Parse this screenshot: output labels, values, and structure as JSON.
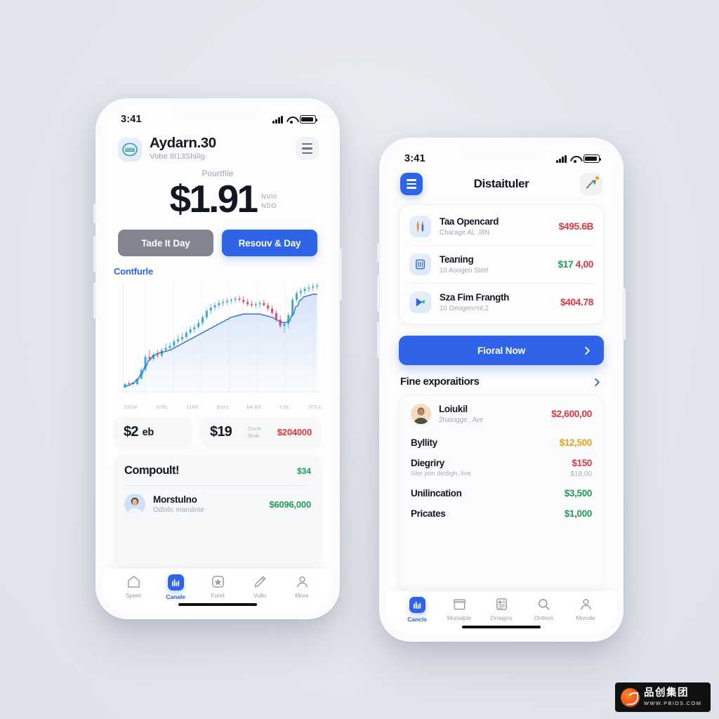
{
  "background_color": "#e3e6ec",
  "accent_blue": "#2f63e8",
  "green": "#1f9d55",
  "red": "#e0373f",
  "amber": "#e7a118",
  "phone1": {
    "status": {
      "time": "3:41",
      "icons": [
        "signal-bars",
        "wifi",
        "battery"
      ]
    },
    "header": {
      "logo_icon": "coin-logo-icon",
      "title": "Aydarn.30",
      "subtitle": "Vobe 8l13Shiilg·",
      "menu_icon": "hamburger-menu-icon"
    },
    "balance": {
      "label": "Pourtfile",
      "amount": "$1.91",
      "unit_lines": [
        "NVI0",
        "NDO"
      ]
    },
    "actions": {
      "secondary_label": "Tade It Day",
      "primary_label": "Resouv & Day"
    },
    "chart": {
      "title": "Contfurle",
      "xticks": [
        "20I34",
        "1I/9L",
        "1160",
        "9/yrs",
        "b4.6d",
        "7,0L",
        "2I7Lc"
      ]
    },
    "stats": {
      "card1_amount": "$2",
      "card1_suffix": "eb",
      "card2_amount": "$19",
      "card2_meta": [
        "Corte",
        "Sirat·"
      ],
      "card2_value": "$204000"
    },
    "bottom_card": {
      "title": "Compoult!",
      "value": "$34",
      "row": {
        "avatar_icon": "user-avatar",
        "title": "Morstulno",
        "subtitle": "Odlolic marolinte",
        "value": "$6096,000"
      }
    },
    "tabbar": [
      {
        "label": "Speet",
        "icon": "home-icon",
        "active": false
      },
      {
        "label": "Canale",
        "icon": "chart-icon",
        "active": true
      },
      {
        "label": "Foret",
        "icon": "star-box-icon",
        "active": false
      },
      {
        "label": "Vullo",
        "icon": "pencil-icon",
        "active": false
      },
      {
        "label": "More",
        "icon": "person-icon",
        "active": false
      }
    ]
  },
  "phone2": {
    "status": {
      "time": "3:41",
      "icons": [
        "signal-bars",
        "wifi",
        "battery"
      ]
    },
    "header": {
      "menu_icon": "hamburger-menu-icon",
      "title": "Distaituler",
      "notify_icon": "colorful-badge-icon",
      "notify_badge": true
    },
    "list": [
      {
        "icon": "candlestick-tile-icon",
        "title": "Taa Opencard",
        "subtitle": "Charage AL ,I8N",
        "value": "$495.6B",
        "value_color": "red"
      },
      {
        "icon": "book-tile-icon",
        "title": "Tearıing",
        "subtitle": "10 Aoogen Stert",
        "value": "$17 4,00",
        "value_color": "mixed"
      },
      {
        "icon": "play-tile-icon",
        "title": "Sza Fim Frangth",
        "subtitle": "10 Oeogenı³nI,2",
        "value": "$404.78",
        "value_color": "red"
      }
    ],
    "cta": {
      "label": "Fioral Now",
      "arrow_icon": "chevron-right-icon"
    },
    "section": {
      "title": "Fine exporaitiors",
      "arrow_icon": "chevron-right-icon"
    },
    "card": {
      "profile": {
        "avatar_icon": "user-avatar",
        "name": "Loiukil",
        "subtitle": "2hatogge , Are",
        "value": "$2,600,00",
        "value_color": "red"
      },
      "lines": [
        {
          "title": "Byllity",
          "subtitle": "",
          "value": "$12,500",
          "value2": "",
          "value_color": "amber"
        },
        {
          "title": "Diegriry",
          "subtitle": "Slor jion dedigh, live",
          "value": "$150",
          "value2": "$18.00",
          "value_color": "red"
        },
        {
          "title": "Unilincation",
          "subtitle": "",
          "value": "$3,500",
          "value2": "",
          "value_color": "green"
        },
        {
          "title": "Pricates",
          "subtitle": "",
          "value": "$1,000",
          "value2": "",
          "value_color": "green"
        }
      ]
    },
    "tabbar": [
      {
        "label": "Cancls",
        "icon": "chart-icon",
        "active": true
      },
      {
        "label": "Mortalple",
        "icon": "box-icon",
        "active": false
      },
      {
        "label": "Driaigns",
        "icon": "grid-doc-icon",
        "active": false
      },
      {
        "label": "Ontlent",
        "icon": "search-icon",
        "active": false
      },
      {
        "label": "Morolle",
        "icon": "person-icon",
        "active": false
      }
    ]
  },
  "watermark": {
    "cn": "品创集团",
    "url": "WWW.PBIDS.COM"
  },
  "chart_data": {
    "type": "line",
    "title": "Contfurle",
    "xlabel": "",
    "ylabel": "",
    "grid": true,
    "legend": "none",
    "categories": [
      "20I34",
      "1I/9L",
      "1160",
      "9/yrs",
      "b4.6d",
      "7,0L",
      "2I7Lc"
    ],
    "xlim": [
      0,
      48
    ],
    "ylim": [
      0,
      100
    ],
    "series": [
      {
        "name": "moving-average",
        "type": "line",
        "values": [
          5,
          6,
          8,
          11,
          16,
          23,
          29,
          33,
          35,
          36,
          37,
          38,
          40,
          42,
          44,
          46,
          48,
          50,
          52,
          54,
          56,
          58,
          60,
          62,
          64,
          66,
          68,
          69,
          70,
          71,
          71,
          71,
          71,
          71,
          70,
          69,
          68,
          66,
          64,
          63,
          64,
          70,
          78,
          84,
          87,
          88,
          89,
          89
        ]
      },
      {
        "name": "candles",
        "type": "ohlc",
        "values": [
          [
            4,
            8,
            3,
            7
          ],
          [
            7,
            10,
            6,
            8
          ],
          [
            8,
            9,
            6,
            7
          ],
          [
            7,
            13,
            6,
            12
          ],
          [
            12,
            22,
            11,
            20
          ],
          [
            20,
            34,
            18,
            32
          ],
          [
            32,
            38,
            28,
            30
          ],
          [
            30,
            36,
            28,
            34
          ],
          [
            34,
            38,
            31,
            33
          ],
          [
            33,
            40,
            31,
            38
          ],
          [
            38,
            44,
            36,
            40
          ],
          [
            40,
            45,
            38,
            42
          ],
          [
            42,
            48,
            40,
            46
          ],
          [
            46,
            52,
            44,
            48
          ],
          [
            48,
            54,
            45,
            50
          ],
          [
            50,
            56,
            48,
            54
          ],
          [
            54,
            60,
            52,
            57
          ],
          [
            57,
            62,
            54,
            59
          ],
          [
            59,
            66,
            57,
            63
          ],
          [
            63,
            70,
            61,
            68
          ],
          [
            68,
            76,
            66,
            74
          ],
          [
            74,
            80,
            71,
            77
          ],
          [
            77,
            82,
            74,
            79
          ],
          [
            79,
            84,
            76,
            81
          ],
          [
            81,
            85,
            78,
            82
          ],
          [
            82,
            86,
            79,
            83
          ],
          [
            83,
            86,
            80,
            84
          ],
          [
            84,
            87,
            81,
            85
          ],
          [
            85,
            88,
            82,
            84
          ],
          [
            84,
            87,
            80,
            82
          ],
          [
            82,
            85,
            78,
            80
          ],
          [
            80,
            83,
            77,
            79
          ],
          [
            79,
            82,
            76,
            80
          ],
          [
            80,
            83,
            77,
            81
          ],
          [
            81,
            84,
            78,
            79
          ],
          [
            79,
            81,
            74,
            76
          ],
          [
            76,
            79,
            70,
            72
          ],
          [
            72,
            75,
            64,
            66
          ],
          [
            66,
            70,
            58,
            60
          ],
          [
            60,
            64,
            54,
            62
          ],
          [
            62,
            72,
            58,
            70
          ],
          [
            70,
            86,
            68,
            84
          ],
          [
            84,
            92,
            82,
            90
          ],
          [
            90,
            95,
            87,
            92
          ],
          [
            92,
            96,
            89,
            94
          ],
          [
            94,
            98,
            91,
            95
          ],
          [
            95,
            99,
            92,
            96
          ],
          [
            96,
            99,
            93,
            97
          ]
        ]
      }
    ],
    "area_fill": "#cfe0f7",
    "up_color": "#2fa8d8",
    "down_color": "#e0456b",
    "line_color": "#3d6fd4"
  }
}
